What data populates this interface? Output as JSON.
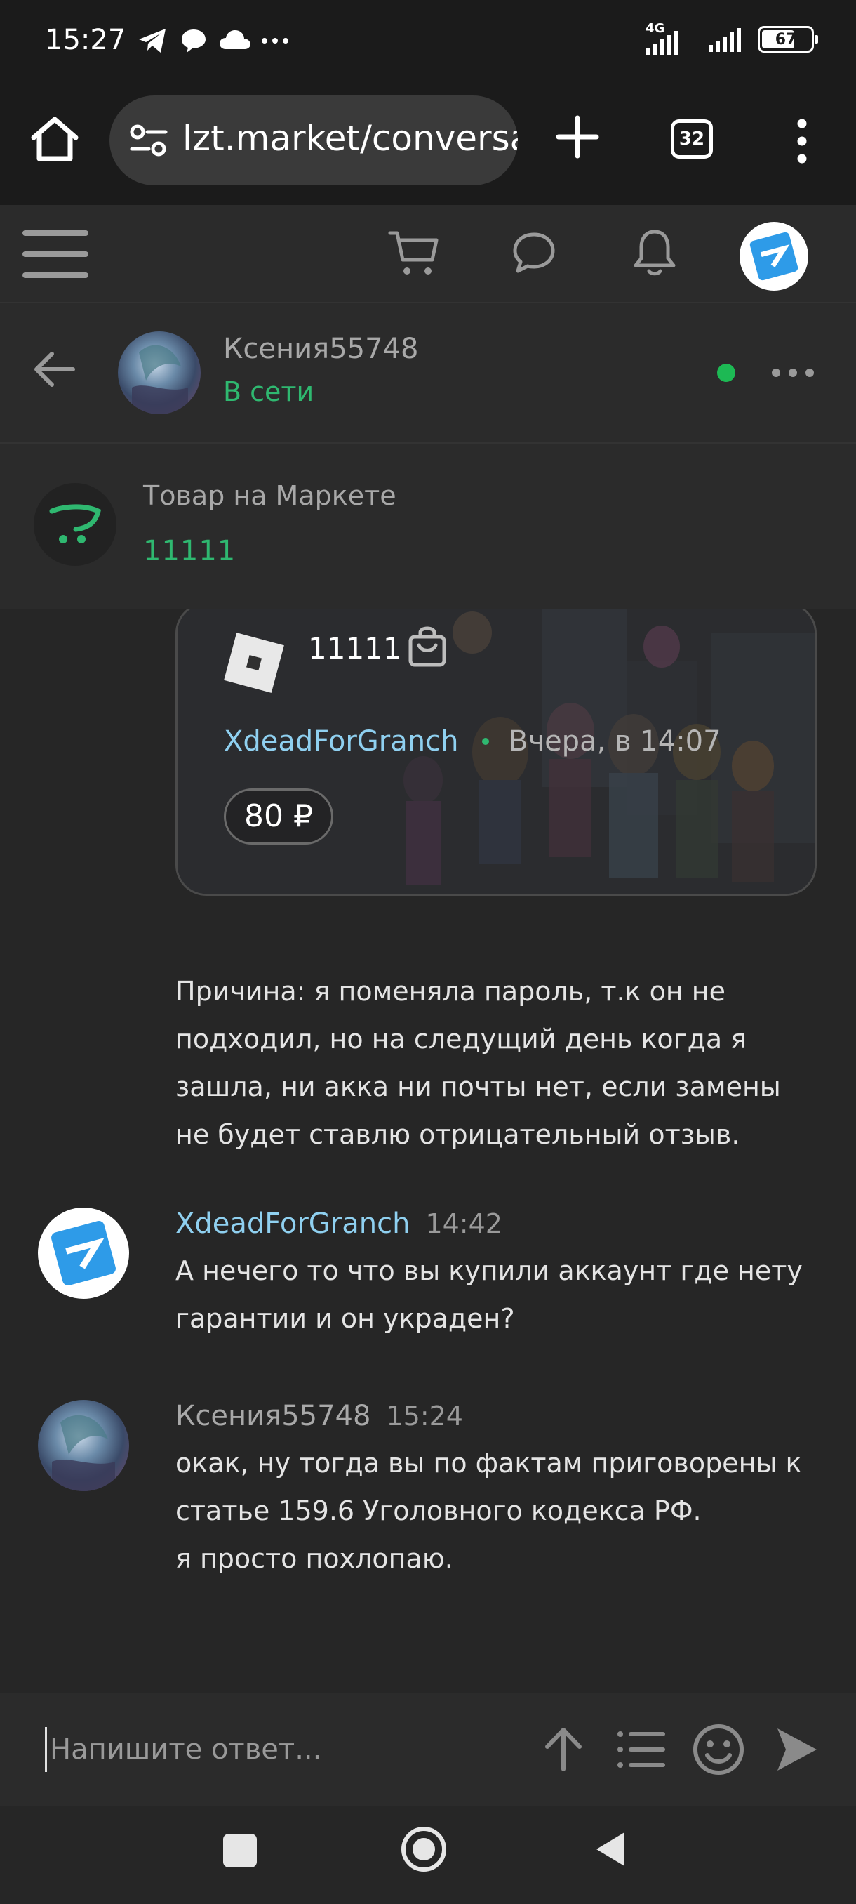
{
  "status_bar": {
    "time": "15:27",
    "network": "4G",
    "battery": "67",
    "battery_percent": 67,
    "icons": [
      "telegram-icon",
      "chat-bubble-icon",
      "cloud-icon",
      "more-dots-icon",
      "signal-icon",
      "battery-icon"
    ]
  },
  "browser": {
    "url": "lzt.market/conversa",
    "tab_count": "32"
  },
  "conversation": {
    "partner_name": "Ксения55748",
    "partner_status": "В сети",
    "status_color": "#2fb870"
  },
  "product_bar": {
    "label": "Товар на Маркете",
    "value": "11111"
  },
  "product_card": {
    "title": "11111",
    "seller": "XdeadForGranch",
    "date": "Вчера, в 14:07",
    "price": "80 ₽"
  },
  "messages": {
    "reason_text": "Причина: я поменяла пароль, т.к он не\nподходил, но на следущий день когда я\nзашла, ни акка ни почты нет, если замены\nне будет ставлю отрицательный отзыв.",
    "items": [
      {
        "author": "XdeadForGranch",
        "time": "14:42",
        "text": "А нечего то что вы купили аккаунт где нету\nгарантии и он украден?"
      },
      {
        "author": "Ксения55748",
        "time": "15:24",
        "text": "окак, ну тогда вы по фактам приговорены к\nстатье 159.6 Уголовного кодекса РФ.\nя просто похлопаю."
      }
    ]
  },
  "composer": {
    "placeholder": "Напишите ответ..."
  },
  "colors": {
    "accent_green": "#2fb870",
    "seller_blue": "#8fd0f0",
    "background": "#262626"
  }
}
